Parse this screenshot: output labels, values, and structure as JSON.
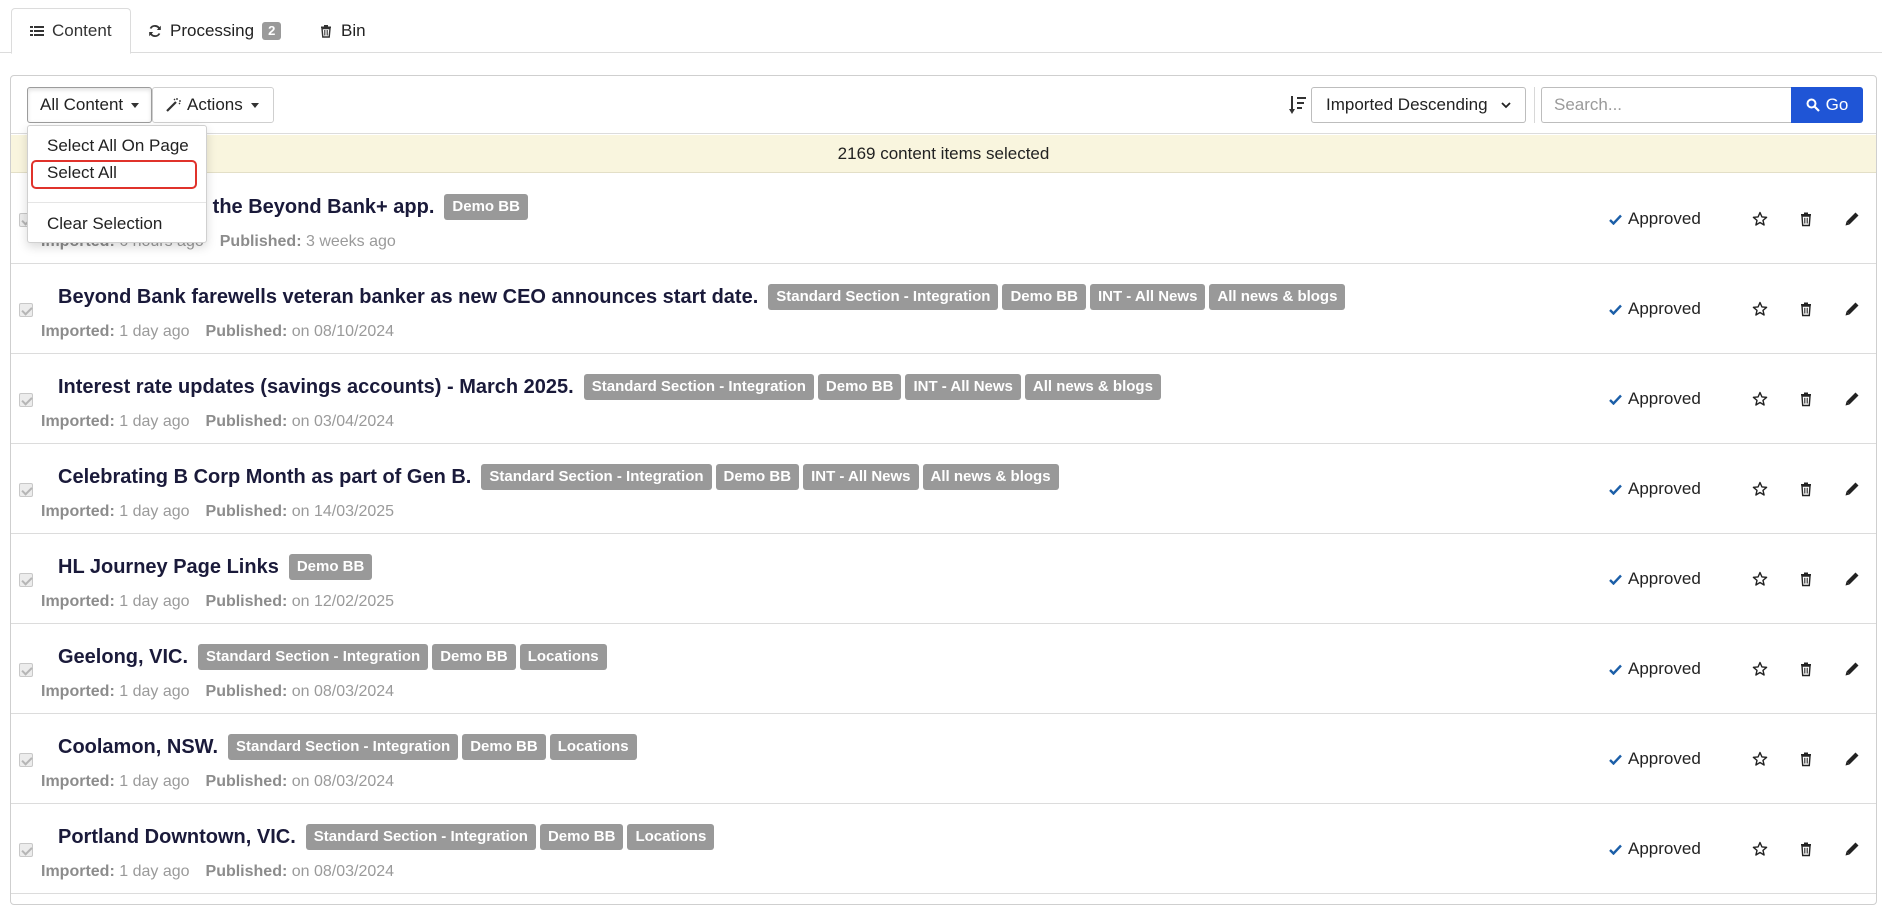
{
  "tabs": [
    {
      "label": "Content",
      "icon": "list-icon",
      "active": true
    },
    {
      "label": "Processing",
      "icon": "refresh-icon",
      "badge": "2"
    },
    {
      "label": "Bin",
      "icon": "trash-icon"
    }
  ],
  "toolbar": {
    "all_content_label": "All Content",
    "actions_label": "Actions",
    "sort_selected": "Imported Descending",
    "search_placeholder": "Search...",
    "search_value": "",
    "go_label": "Go"
  },
  "dropdown": {
    "items": [
      "Select All On Page",
      "Select All",
      "Clear Selection"
    ],
    "highlighted": "Select All"
  },
  "selection_message": "2169 content items selected",
  "labels": {
    "imported": "Imported:",
    "published": "Published:"
  },
  "rows": [
    {
      "title": "Changes to the Beyond Bank+ app.",
      "title_visible": "nges to the Beyond Bank+ app.",
      "tags": [
        "Demo BB"
      ],
      "imported": "6 hours ago",
      "published": "3 weeks ago",
      "status": "Approved"
    },
    {
      "title": "Beyond Bank farewells veteran banker as new CEO announces start date.",
      "tags": [
        "Standard Section - Integration",
        "Demo BB",
        "INT - All News",
        "All news & blogs"
      ],
      "imported": "1 day ago",
      "published": "on 08/10/2024",
      "status": "Approved"
    },
    {
      "title": "Interest rate updates (savings accounts) - March 2025.",
      "tags": [
        "Standard Section - Integration",
        "Demo BB",
        "INT - All News",
        "All news & blogs"
      ],
      "imported": "1 day ago",
      "published": "on 03/04/2024",
      "status": "Approved"
    },
    {
      "title": "Celebrating B Corp Month as part of Gen B.",
      "tags": [
        "Standard Section - Integration",
        "Demo BB",
        "INT - All News",
        "All news & blogs"
      ],
      "imported": "1 day ago",
      "published": "on 14/03/2025",
      "status": "Approved"
    },
    {
      "title": "HL Journey Page Links",
      "tags": [
        "Demo BB"
      ],
      "imported": "1 day ago",
      "published": "on 12/02/2025",
      "status": "Approved"
    },
    {
      "title": "Geelong, VIC.",
      "tags": [
        "Standard Section - Integration",
        "Demo BB",
        "Locations"
      ],
      "imported": "1 day ago",
      "published": "on 08/03/2024",
      "status": "Approved"
    },
    {
      "title": "Coolamon, NSW.",
      "tags": [
        "Standard Section - Integration",
        "Demo BB",
        "Locations"
      ],
      "imported": "1 day ago",
      "published": "on 08/03/2024",
      "status": "Approved"
    },
    {
      "title": "Portland Downtown, VIC.",
      "tags": [
        "Standard Section - Integration",
        "Demo BB",
        "Locations"
      ],
      "imported": "1 day ago",
      "published": "on 08/03/2024",
      "status": "Approved"
    }
  ],
  "colors": {
    "accent": "#1f55d6",
    "tag_bg": "#999999",
    "selection_bar": "#f9f5de",
    "highlight": "#e0322b",
    "check": "#1c5fa8"
  }
}
